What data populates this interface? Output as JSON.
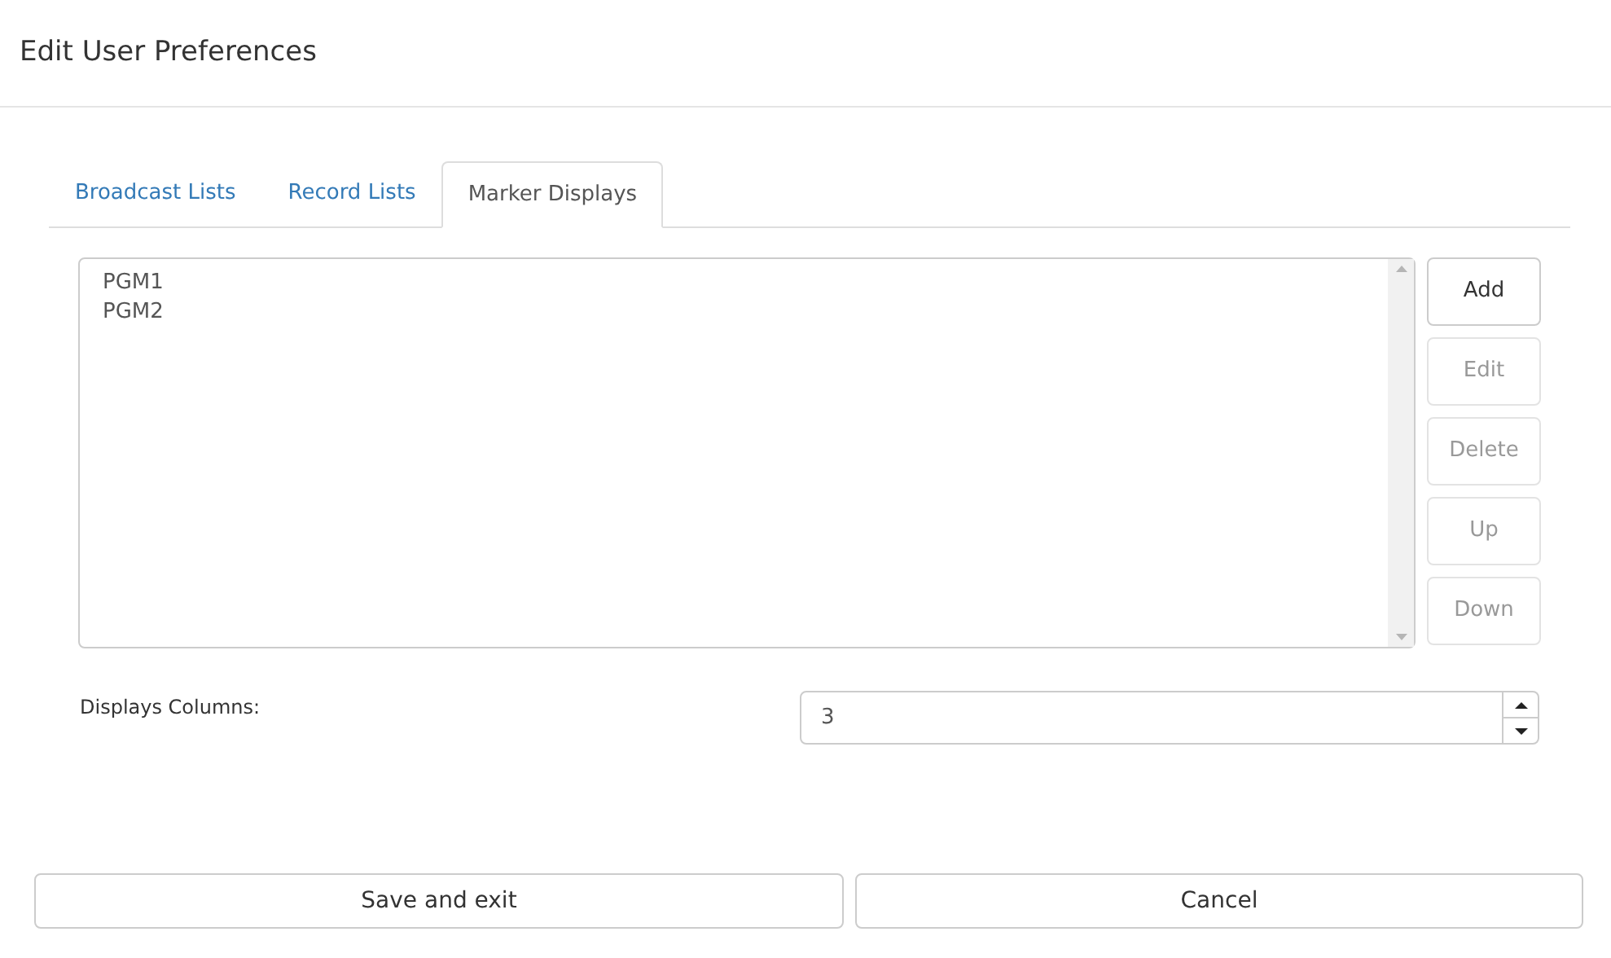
{
  "dialog": {
    "title": "Edit User Preferences"
  },
  "tabs": [
    {
      "label": "Broadcast Lists",
      "selected": false
    },
    {
      "label": "Record Lists",
      "selected": false
    },
    {
      "label": "Marker Displays",
      "selected": true
    }
  ],
  "list": {
    "items": [
      "PGM1",
      "PGM2"
    ]
  },
  "side_buttons": [
    {
      "label": "Add",
      "disabled": false
    },
    {
      "label": "Edit",
      "disabled": true
    },
    {
      "label": "Delete",
      "disabled": true
    },
    {
      "label": "Up",
      "disabled": true
    },
    {
      "label": "Down",
      "disabled": true
    }
  ],
  "columns_field": {
    "label": "Displays Columns:",
    "value": "3"
  },
  "footer_buttons": [
    "Save and exit",
    "Cancel"
  ]
}
